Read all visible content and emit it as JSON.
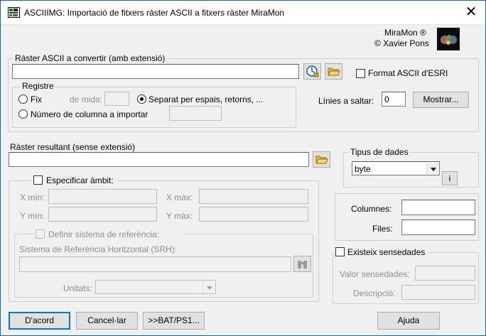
{
  "window": {
    "title": "ASCIIIMG: Importació de fitxers ràster ASCII a fitxers ràster MiraMon",
    "close_glyph": "✕"
  },
  "brand": {
    "line1": "MiraMon ®",
    "line2": "© Xavier Pons"
  },
  "input_raster": {
    "group_label": "Ràster ASCII a convertir (amb extensió)",
    "value": "",
    "esri_label": "Format ASCII d'ESRI",
    "esri_checked": false
  },
  "registre": {
    "group_label": "Registre",
    "fix_label": "Fix",
    "fix_selected": false,
    "mida_label": "de mida:",
    "mida_value": "",
    "separat_label": "Separat per espais, retorns, ...",
    "separat_selected": true,
    "num_col_label": "Número de columna a importar",
    "num_col_selected": false,
    "num_col_value": ""
  },
  "skip": {
    "label": "Línies a saltar:",
    "value": "0",
    "show_button": "Mostrar..."
  },
  "output_raster": {
    "label": "Ràster resultant (sense extensió)",
    "value": ""
  },
  "data_type": {
    "group_label": "Tipus de dades",
    "selected": "byte",
    "info_button": "i"
  },
  "ambit": {
    "label": "Especificar àmbit:",
    "checked": false,
    "xmin_label": "X mín:",
    "xmax_label": "X màx:",
    "ymin_label": "Y mín:",
    "ymax_label": "Y màx:",
    "xmin": "",
    "xmax": "",
    "ymin": "",
    "ymax": ""
  },
  "ref_system": {
    "label": "Definir sistema de referència:",
    "checked": false,
    "srh_label": "Sistema de Referència Horitzontal (SRH):",
    "srh_value": "",
    "units_label": "Unitats:",
    "units_value": ""
  },
  "dimensions": {
    "columns_label": "Columnes:",
    "rows_label": "Files:",
    "columns": "",
    "rows": ""
  },
  "nodata": {
    "label": "Existeix sensedades",
    "checked": false,
    "value_label": "Valor sensedades:",
    "desc_label": "Descripció:",
    "value": "",
    "desc": ""
  },
  "buttons": {
    "ok": "D'acord",
    "cancel": "Cancel·lar",
    "bat": ">>BAT/PS1...",
    "help": "Ajuda"
  },
  "colors": {
    "accent": "#0078d7",
    "window_border": "#1a5fb4",
    "face": "#f0f0f0"
  },
  "icons": [
    "app-icon",
    "close-icon",
    "miramon-logo-icon",
    "browse-globe-icon",
    "folder-open-icon",
    "binoculars-icon",
    "chevron-down-icon"
  ]
}
